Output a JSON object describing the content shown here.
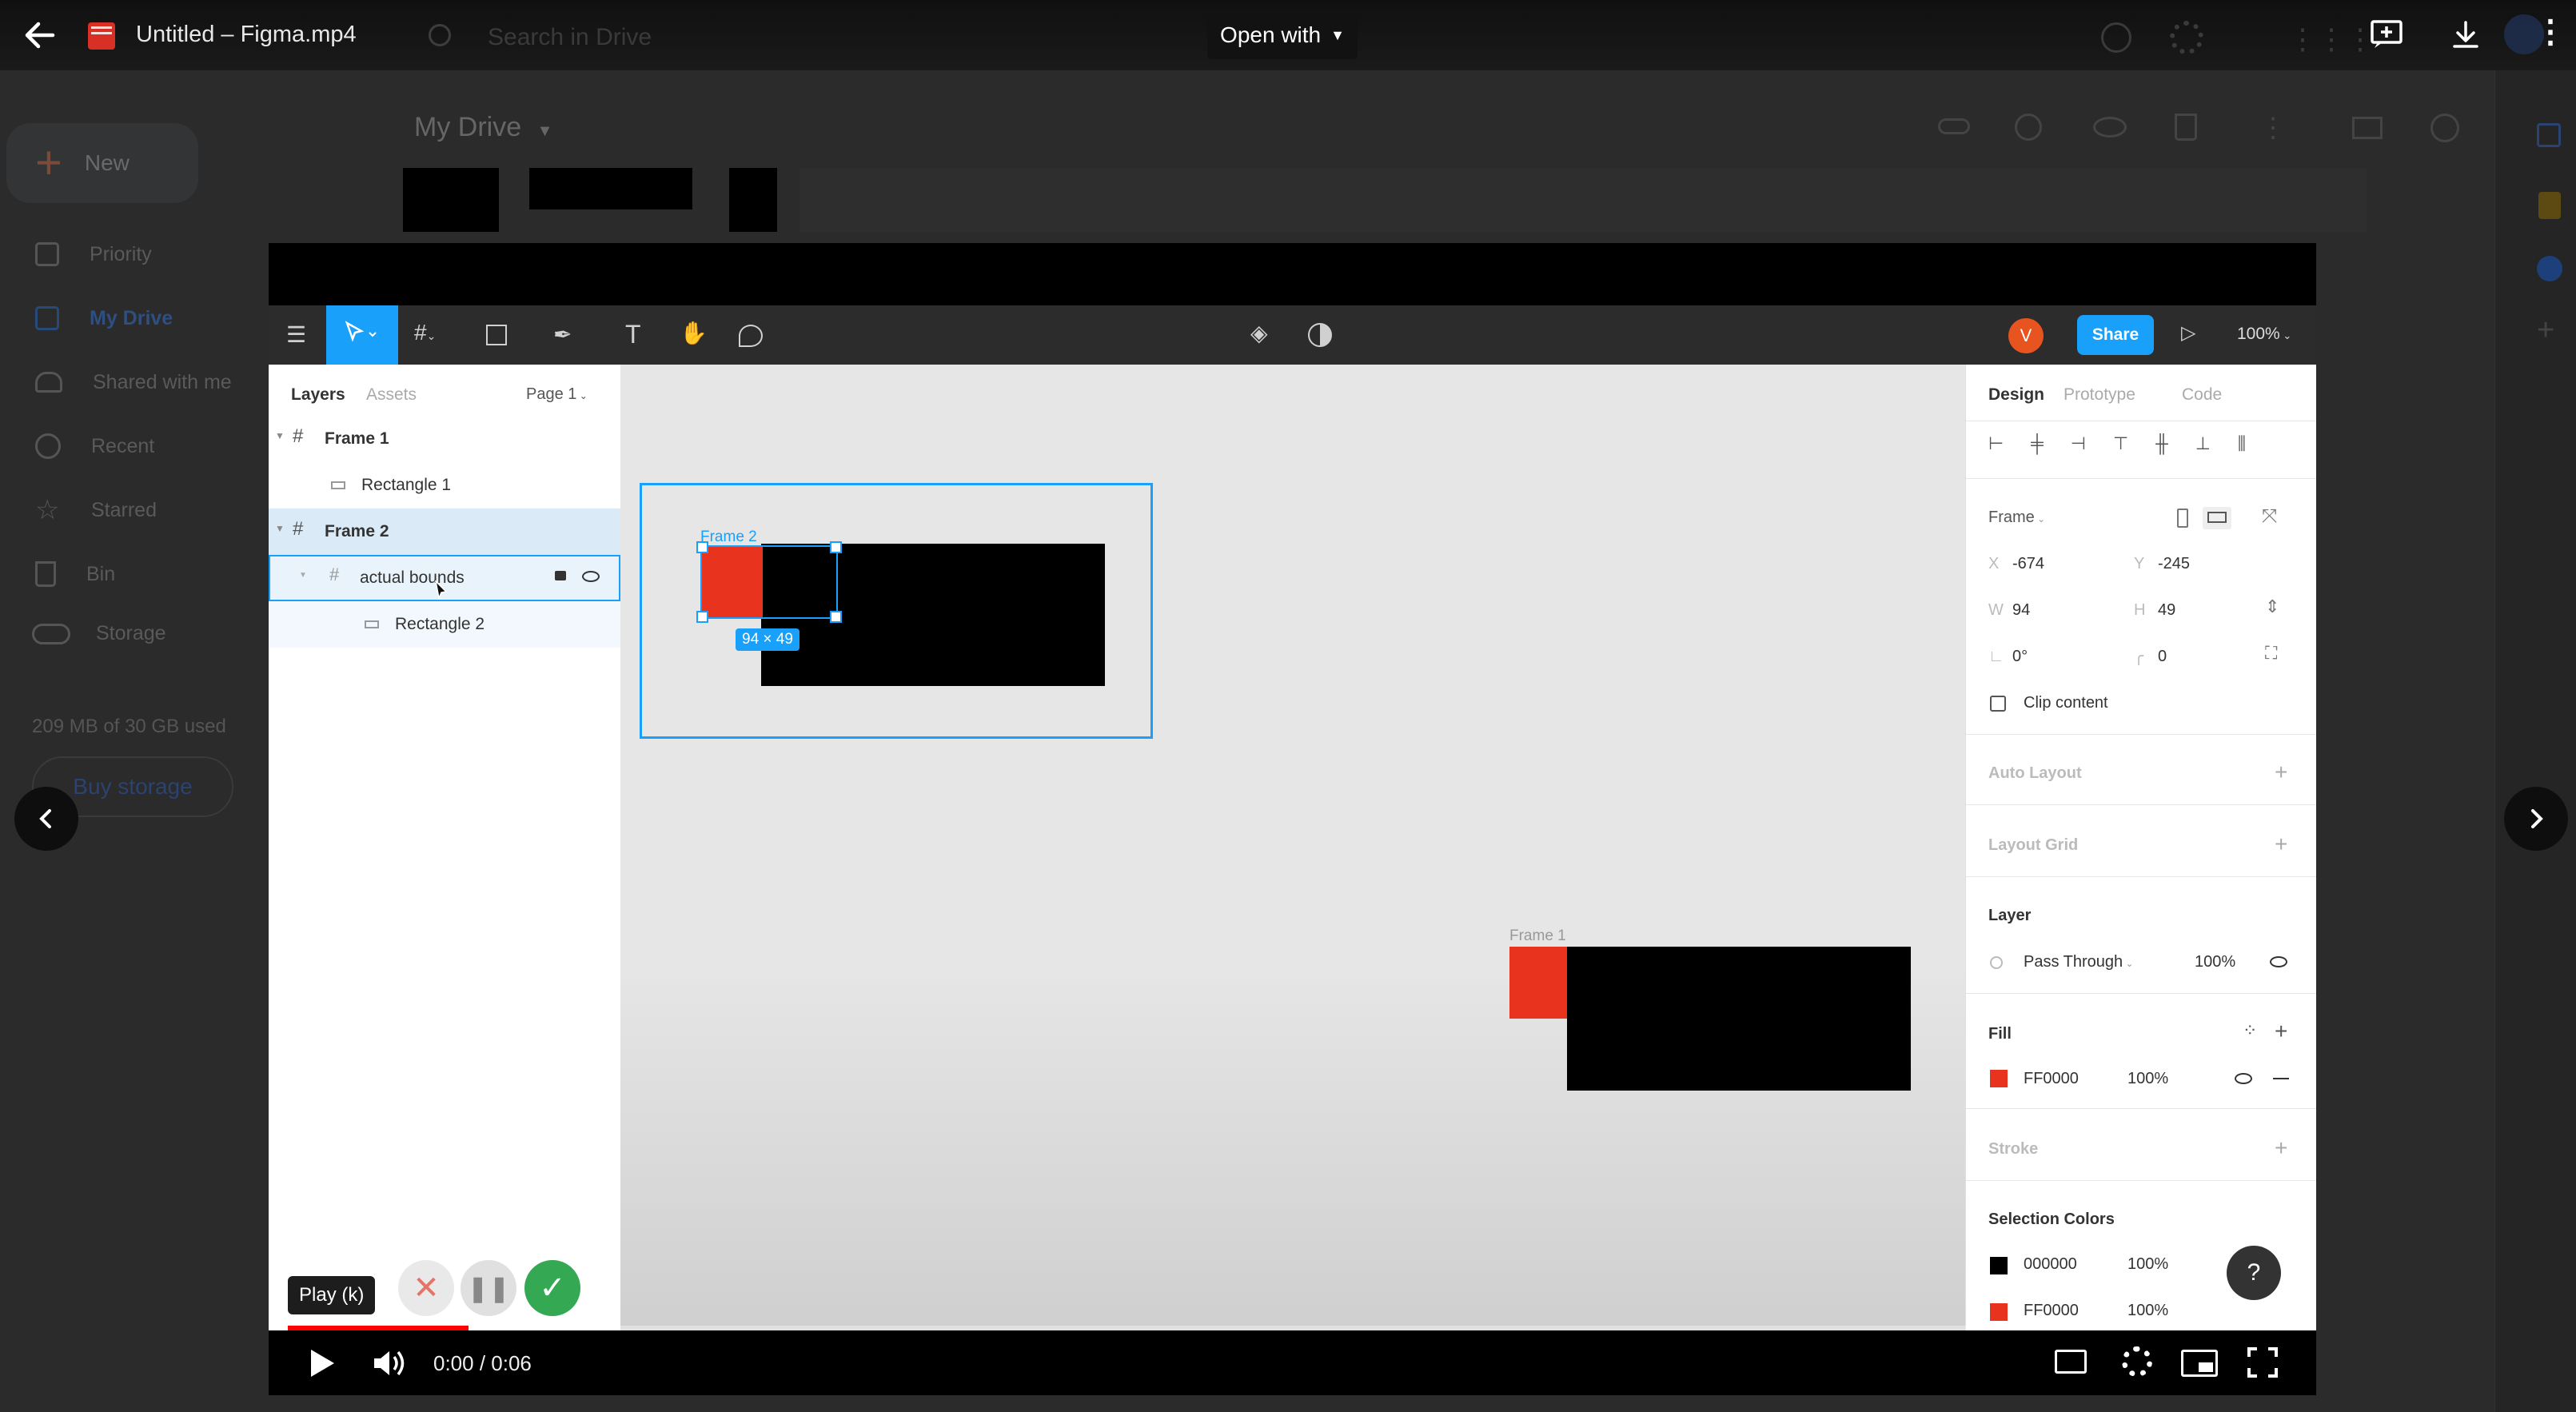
{
  "viewer": {
    "file_title": "Untitled – Figma.mp4",
    "open_with_label": "Open with"
  },
  "drive": {
    "search_placeholder": "Search in Drive",
    "new_label": "New",
    "breadcrumb": "My Drive",
    "nav": [
      {
        "label": "Priority"
      },
      {
        "label": "My Drive"
      },
      {
        "label": "Shared with me"
      },
      {
        "label": "Recent"
      },
      {
        "label": "Starred"
      },
      {
        "label": "Bin"
      }
    ],
    "storage_label": "Storage",
    "storage_used": "209 MB of 30 GB used",
    "buy_storage": "Buy storage"
  },
  "figma": {
    "avatar_initial": "V",
    "share_label": "Share",
    "zoom": "100%",
    "tabs_left": {
      "layers": "Layers",
      "assets": "Assets",
      "page": "Page 1"
    },
    "layers": [
      {
        "name": "Frame 1"
      },
      {
        "name": "Rectangle 1"
      },
      {
        "name": "Frame 2"
      },
      {
        "name": "actual bounds"
      },
      {
        "name": "Rectangle 2"
      }
    ],
    "canvas": {
      "frame2_label": "Frame 2",
      "frame1_label": "Frame 1",
      "size_badge": "94 × 49"
    },
    "tabs_right": {
      "design": "Design",
      "prototype": "Prototype",
      "code": "Code"
    },
    "frame_label": "Frame",
    "x_label": "X",
    "x_value": "-674",
    "y_label": "Y",
    "y_value": "-245",
    "w_label": "W",
    "w_value": "94",
    "h_label": "H",
    "h_value": "49",
    "rotation_value": "0°",
    "radius_value": "0",
    "clip_content": "Clip content",
    "auto_layout": "Auto Layout",
    "layout_grid": "Layout Grid",
    "layer_title": "Layer",
    "blend_mode": "Pass Through",
    "layer_opacity": "100%",
    "fill_title": "Fill",
    "fill_hex": "FF0000",
    "fill_opacity": "100%",
    "stroke_title": "Stroke",
    "selection_colors_title": "Selection Colors",
    "selection_colors": [
      {
        "hex": "000000",
        "opacity": "100%"
      },
      {
        "hex": "FF0000",
        "opacity": "100%"
      }
    ],
    "help": "?"
  },
  "player": {
    "tooltip": "Play (k)",
    "time": "0:00 / 0:06",
    "progress": 0.09
  },
  "colors": {
    "accent_blue": "#18a0fb",
    "red": "#e8331f",
    "share_blue": "#18a0fb",
    "player_red": "#ff0000"
  }
}
